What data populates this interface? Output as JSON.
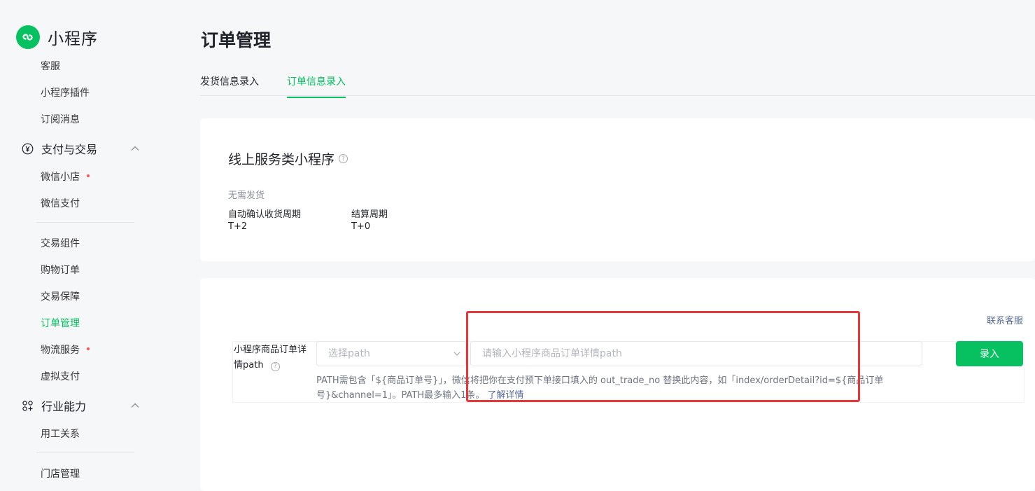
{
  "brand": {
    "title": "小程序"
  },
  "sidebar": {
    "items_top": [
      {
        "label": "客服"
      },
      {
        "label": "小程序插件"
      },
      {
        "label": "订阅消息"
      }
    ],
    "group_pay": {
      "label": "支付与交易"
    },
    "pay_items_a": [
      {
        "label": "微信小店"
      },
      {
        "label": "微信支付"
      }
    ],
    "pay_items_b": [
      {
        "label": "交易组件"
      },
      {
        "label": "购物订单"
      },
      {
        "label": "交易保障"
      },
      {
        "label": "订单管理"
      },
      {
        "label": "物流服务"
      },
      {
        "label": "虚拟支付"
      }
    ],
    "group_industry": {
      "label": "行业能力"
    },
    "industry_items_a": [
      {
        "label": "用工关系"
      }
    ],
    "industry_items_b": [
      {
        "label": "门店管理"
      }
    ]
  },
  "page": {
    "title": "订单管理",
    "tabs": [
      {
        "label": "发货信息录入"
      },
      {
        "label": "订单信息录入"
      }
    ]
  },
  "service_card": {
    "title": "线上服务类小程序",
    "no_shipping": "无需发货",
    "confirm_label": "自动确认收货周期",
    "confirm_value": "T+2",
    "settle_label": "结算周期",
    "settle_value": "T+0"
  },
  "path_card": {
    "contact": "联系客服",
    "label": "小程序商品订单详情path",
    "select_placeholder": "选择path",
    "input_placeholder": "请输入小程序商品订单详情path",
    "submit": "录入",
    "hint": "PATH需包含「${商品订单号}」，微信将把你在支付预下单接口填入的 out_trade_no 替换此内容，如「index/orderDetail?id=${商品订单号}&channel=1」。PATH最多输入1条。",
    "hint_link": "了解详情"
  },
  "colors": {
    "accent": "#07c160",
    "link": "#576b95",
    "highlight": "#e5383b",
    "badge": "#fa5151"
  }
}
